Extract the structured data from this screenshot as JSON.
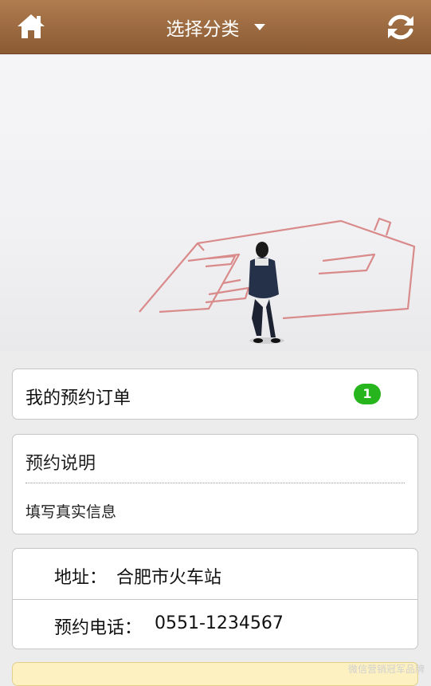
{
  "header": {
    "title": "选择分类",
    "home_icon": "home-icon",
    "refresh_icon": "refresh-icon",
    "dropdown_icon": "caret-down-icon"
  },
  "orders": {
    "label": "我的预约订单",
    "count": "1"
  },
  "info": {
    "title": "预约说明",
    "text": "填写真实信息"
  },
  "contact": {
    "address_label": "地址：",
    "address_value": "合肥市火车站",
    "phone_label": "预约电话：",
    "phone_value": "0551-1234567"
  },
  "watermark": "微信营销冠军品牌",
  "colors": {
    "header": "#9a6a40",
    "badge": "#27b51d",
    "background": "#ececec"
  }
}
